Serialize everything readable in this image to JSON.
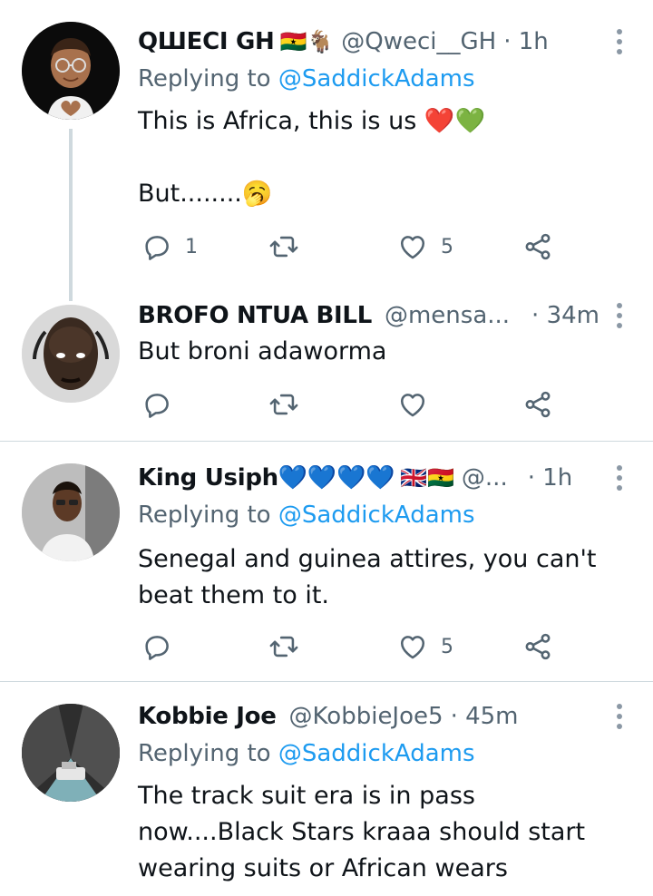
{
  "tweets": [
    {
      "name": "QШЕCI GH",
      "flags": "🇬🇭🐐",
      "handle": "@Qweci__GH",
      "time": "· 1h",
      "replying_prefix": "Replying to",
      "replying_to": "@SaddickAdams",
      "text": "This is Africa, this is us ❤️💚\n\nBut........🥱",
      "replies": "1",
      "retweets": "",
      "likes": "5"
    },
    {
      "name": "BROFO NTUA BILL",
      "flags": "",
      "handle": "@mensa...",
      "time": "· 34m",
      "replying_prefix": "",
      "replying_to": "",
      "text": "But broni adaworma",
      "replies": "",
      "retweets": "",
      "likes": ""
    },
    {
      "name": "King Usiph💙💙💙💙",
      "flags": "🇬🇧🇬🇭",
      "handle": "@...",
      "time": "· 1h",
      "replying_prefix": "Replying to",
      "replying_to": "@SaddickAdams",
      "text": "Senegal and guinea attires, you can't\nbeat them to it.",
      "replies": "",
      "retweets": "",
      "likes": "5"
    },
    {
      "name": "Kobbie Joe",
      "flags": "",
      "handle": "@KobbieJoe5",
      "time": "· 45m",
      "replying_prefix": "Replying to",
      "replying_to": "@SaddickAdams",
      "text": "The track suit era is in pass\nnow....Black Stars kraaa should start\nwearing suits or African wears",
      "replies": "",
      "retweets": "",
      "likes": ""
    }
  ],
  "icons": {
    "reply": "reply-icon",
    "retweet": "retweet-icon",
    "like": "heart-icon",
    "share": "share-icon",
    "more": "more-icon"
  },
  "colors": {
    "accent": "#1d9bf0",
    "secondary_text": "#536471",
    "divider": "#cfd9de"
  }
}
